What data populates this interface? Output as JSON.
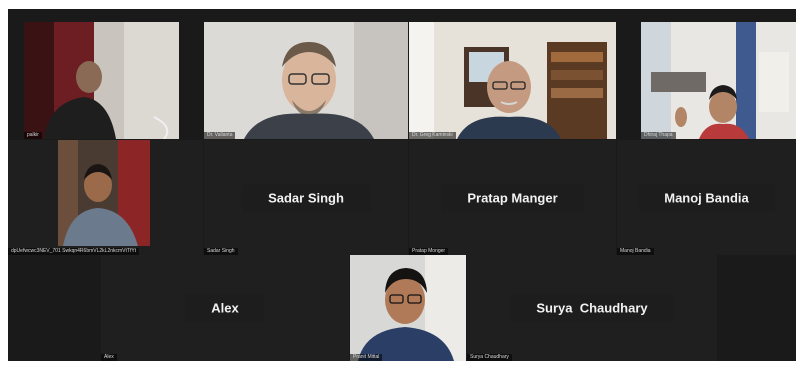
{
  "participants": [
    {
      "id": "p1",
      "label": "palkir",
      "kind": "video"
    },
    {
      "id": "p2",
      "label": "Dr. Vallanta",
      "kind": "video"
    },
    {
      "id": "p3",
      "label": "Dr. Greg Kaminski",
      "kind": "video"
    },
    {
      "id": "p4",
      "label": "Dhiraj Thapa",
      "kind": "video"
    },
    {
      "id": "p5",
      "label": "dpUefwcwc3NEV_701 Swkqn4R6bmVL2kL2nkcmVtTfYt",
      "kind": "video"
    },
    {
      "id": "p6",
      "label": "Sadar Singh",
      "display_name": "Sadar Singh",
      "kind": "name"
    },
    {
      "id": "p7",
      "label": "Pratap Monger",
      "display_name": "Pratap Manger",
      "kind": "name"
    },
    {
      "id": "p8",
      "label": "Manoj Bandia",
      "display_name": "Manoj Bandia",
      "kind": "name"
    },
    {
      "id": "p9",
      "label": "Alex",
      "display_name": "Alex",
      "kind": "name"
    },
    {
      "id": "p10",
      "label": "Pranit Mittal",
      "kind": "video"
    },
    {
      "id": "p11",
      "label": "Surya Chaudhary",
      "display_name": "Surya  Chaudhary",
      "kind": "name"
    }
  ],
  "colors": {
    "stage": "#1a1a1a",
    "tile": "#262626",
    "name_text": "#f2f2f2"
  }
}
